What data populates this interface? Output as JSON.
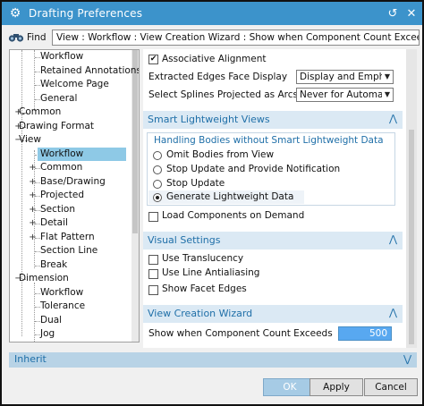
{
  "titlebar": {
    "title": "Drafting Preferences",
    "close_glyph": "✕",
    "reset_glyph": "↺",
    "app_icon": "gear-icon"
  },
  "find": {
    "label": "Find",
    "value": "View : Workflow : View Creation Wizard : Show when Component Count Exceeds \"...large...\""
  },
  "tree": {
    "items": [
      {
        "label": "Workflow",
        "level": 2,
        "expander": ""
      },
      {
        "label": "Retained Annotations",
        "level": 2,
        "expander": ""
      },
      {
        "label": "Welcome Page",
        "level": 2,
        "expander": ""
      },
      {
        "label": "General",
        "level": 2,
        "expander": ""
      },
      {
        "label": "Common",
        "level": 1,
        "expander": "+"
      },
      {
        "label": "Drawing Format",
        "level": 1,
        "expander": "+"
      },
      {
        "label": "View",
        "level": 1,
        "expander": "−"
      },
      {
        "label": "Workflow",
        "level": 2,
        "expander": "",
        "selected": true
      },
      {
        "label": "Common",
        "level": 2,
        "expander": "+"
      },
      {
        "label": "Base/Drawing",
        "level": 2,
        "expander": "+"
      },
      {
        "label": "Projected",
        "level": 2,
        "expander": "+"
      },
      {
        "label": "Section",
        "level": 2,
        "expander": "+"
      },
      {
        "label": "Detail",
        "level": 2,
        "expander": "+"
      },
      {
        "label": "Flat Pattern",
        "level": 2,
        "expander": "+"
      },
      {
        "label": "Section Line",
        "level": 2,
        "expander": ""
      },
      {
        "label": "Break",
        "level": 2,
        "expander": ""
      },
      {
        "label": "Dimension",
        "level": 1,
        "expander": "−"
      },
      {
        "label": "Workflow",
        "level": 2,
        "expander": ""
      },
      {
        "label": "Tolerance",
        "level": 2,
        "expander": ""
      },
      {
        "label": "Dual",
        "level": 2,
        "expander": ""
      },
      {
        "label": "Jog",
        "level": 2,
        "expander": ""
      }
    ]
  },
  "top_options": {
    "associative_alignment": {
      "label": "Associative Alignment",
      "checked": true,
      "check_glyph": "✔"
    },
    "extracted_edges": {
      "label": "Extracted Edges Face Display",
      "value": "Display and Emphasize",
      "arrow": "▼"
    },
    "select_splines": {
      "label": "Select Splines Projected as Arcs",
      "value": "Never for Automatic",
      "arrow": "▼"
    }
  },
  "smart_lightweight": {
    "title": "Smart Lightweight Views",
    "chevron": "⋀",
    "group_title": "Handling Bodies without Smart Lightweight Data",
    "radios": [
      {
        "label": "Omit Bodies from View",
        "selected": false
      },
      {
        "label": "Stop Update and Provide Notification",
        "selected": false
      },
      {
        "label": "Stop Update",
        "selected": false
      },
      {
        "label": "Generate Lightweight Data",
        "selected": true
      }
    ],
    "load_on_demand": {
      "label": "Load Components on Demand",
      "checked": false
    }
  },
  "visual_settings": {
    "title": "Visual Settings",
    "chevron": "⋀",
    "options": [
      {
        "label": "Use Translucency",
        "checked": false
      },
      {
        "label": "Use Line Antialiasing",
        "checked": false
      },
      {
        "label": "Show Facet Edges",
        "checked": false
      }
    ]
  },
  "view_creation_wizard": {
    "title": "View Creation Wizard",
    "chevron": "⋀",
    "count_label": "Show when Component Count Exceeds",
    "count_value": "500"
  },
  "inherit": {
    "label": "Inherit",
    "chevron": "⋁"
  },
  "buttons": {
    "ok": "OK",
    "apply": "Apply",
    "cancel": "Cancel"
  }
}
